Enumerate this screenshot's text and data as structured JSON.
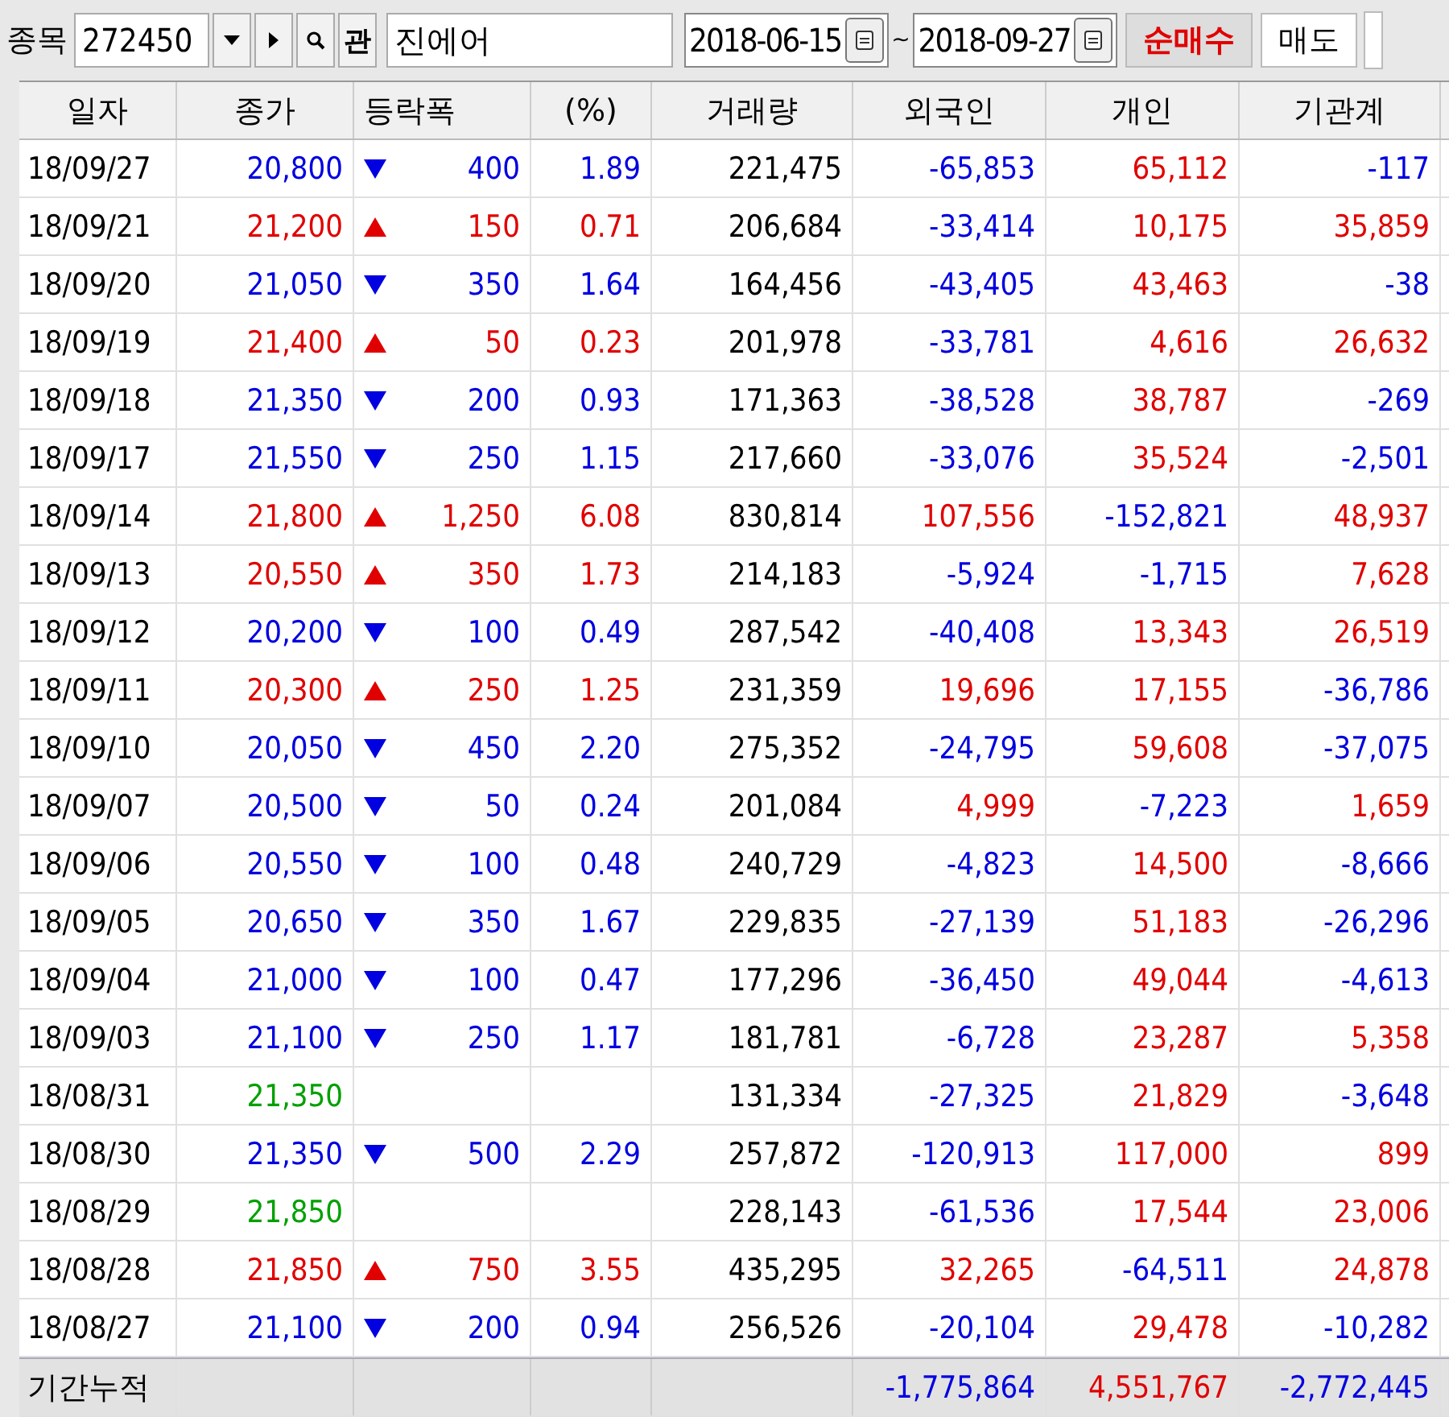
{
  "toolbar": {
    "label": "종목",
    "code": "272450",
    "name_field": "진에어",
    "related_button": "관",
    "start_date": "2018-06-15",
    "tilde": "~",
    "end_date": "2018-09-27",
    "tabs": [
      {
        "label": "순매수",
        "selected": true
      },
      {
        "label": "매도",
        "selected": false
      }
    ]
  },
  "table": {
    "columns": [
      "일자",
      "종가",
      "등락폭",
      "(%)",
      "거래량",
      "외국인",
      "개인",
      "기관계"
    ],
    "rows": [
      {
        "date": "18/09/27",
        "close": "20,800",
        "change": "400",
        "pct": "1.89",
        "kind": "down",
        "volume": "221,475",
        "flows": [
          {
            "text": "-65,853",
            "kind": "neg"
          },
          {
            "text": "65,112",
            "kind": "pos"
          },
          {
            "text": "-117",
            "kind": "neg"
          }
        ]
      },
      {
        "date": "18/09/21",
        "close": "21,200",
        "change": "150",
        "pct": "0.71",
        "kind": "up",
        "volume": "206,684",
        "flows": [
          {
            "text": "-33,414",
            "kind": "neg"
          },
          {
            "text": "10,175",
            "kind": "pos"
          },
          {
            "text": "35,859",
            "kind": "pos"
          }
        ]
      },
      {
        "date": "18/09/20",
        "close": "21,050",
        "change": "350",
        "pct": "1.64",
        "kind": "down",
        "volume": "164,456",
        "flows": [
          {
            "text": "-43,405",
            "kind": "neg"
          },
          {
            "text": "43,463",
            "kind": "pos"
          },
          {
            "text": "-38",
            "kind": "neg"
          }
        ]
      },
      {
        "date": "18/09/19",
        "close": "21,400",
        "change": "50",
        "pct": "0.23",
        "kind": "up",
        "volume": "201,978",
        "flows": [
          {
            "text": "-33,781",
            "kind": "neg"
          },
          {
            "text": "4,616",
            "kind": "pos"
          },
          {
            "text": "26,632",
            "kind": "pos"
          }
        ]
      },
      {
        "date": "18/09/18",
        "close": "21,350",
        "change": "200",
        "pct": "0.93",
        "kind": "down",
        "volume": "171,363",
        "flows": [
          {
            "text": "-38,528",
            "kind": "neg"
          },
          {
            "text": "38,787",
            "kind": "pos"
          },
          {
            "text": "-269",
            "kind": "neg"
          }
        ]
      },
      {
        "date": "18/09/17",
        "close": "21,550",
        "change": "250",
        "pct": "1.15",
        "kind": "down",
        "volume": "217,660",
        "flows": [
          {
            "text": "-33,076",
            "kind": "neg"
          },
          {
            "text": "35,524",
            "kind": "pos"
          },
          {
            "text": "-2,501",
            "kind": "neg"
          }
        ]
      },
      {
        "date": "18/09/14",
        "close": "21,800",
        "change": "1,250",
        "pct": "6.08",
        "kind": "up",
        "volume": "830,814",
        "flows": [
          {
            "text": "107,556",
            "kind": "pos"
          },
          {
            "text": "-152,821",
            "kind": "neg"
          },
          {
            "text": "48,937",
            "kind": "pos"
          }
        ]
      },
      {
        "date": "18/09/13",
        "close": "20,550",
        "change": "350",
        "pct": "1.73",
        "kind": "up",
        "volume": "214,183",
        "flows": [
          {
            "text": "-5,924",
            "kind": "neg"
          },
          {
            "text": "-1,715",
            "kind": "neg"
          },
          {
            "text": "7,628",
            "kind": "pos"
          }
        ]
      },
      {
        "date": "18/09/12",
        "close": "20,200",
        "change": "100",
        "pct": "0.49",
        "kind": "down",
        "volume": "287,542",
        "flows": [
          {
            "text": "-40,408",
            "kind": "neg"
          },
          {
            "text": "13,343",
            "kind": "pos"
          },
          {
            "text": "26,519",
            "kind": "pos"
          }
        ]
      },
      {
        "date": "18/09/11",
        "close": "20,300",
        "change": "250",
        "pct": "1.25",
        "kind": "up",
        "volume": "231,359",
        "flows": [
          {
            "text": "19,696",
            "kind": "pos"
          },
          {
            "text": "17,155",
            "kind": "pos"
          },
          {
            "text": "-36,786",
            "kind": "neg"
          }
        ]
      },
      {
        "date": "18/09/10",
        "close": "20,050",
        "change": "450",
        "pct": "2.20",
        "kind": "down",
        "volume": "275,352",
        "flows": [
          {
            "text": "-24,795",
            "kind": "neg"
          },
          {
            "text": "59,608",
            "kind": "pos"
          },
          {
            "text": "-37,075",
            "kind": "neg"
          }
        ]
      },
      {
        "date": "18/09/07",
        "close": "20,500",
        "change": "50",
        "pct": "0.24",
        "kind": "down",
        "volume": "201,084",
        "flows": [
          {
            "text": "4,999",
            "kind": "pos"
          },
          {
            "text": "-7,223",
            "kind": "neg"
          },
          {
            "text": "1,659",
            "kind": "pos"
          }
        ]
      },
      {
        "date": "18/09/06",
        "close": "20,550",
        "change": "100",
        "pct": "0.48",
        "kind": "down",
        "volume": "240,729",
        "flows": [
          {
            "text": "-4,823",
            "kind": "neg"
          },
          {
            "text": "14,500",
            "kind": "pos"
          },
          {
            "text": "-8,666",
            "kind": "neg"
          }
        ]
      },
      {
        "date": "18/09/05",
        "close": "20,650",
        "change": "350",
        "pct": "1.67",
        "kind": "down",
        "volume": "229,835",
        "flows": [
          {
            "text": "-27,139",
            "kind": "neg"
          },
          {
            "text": "51,183",
            "kind": "pos"
          },
          {
            "text": "-26,296",
            "kind": "neg"
          }
        ]
      },
      {
        "date": "18/09/04",
        "close": "21,000",
        "change": "100",
        "pct": "0.47",
        "kind": "down",
        "volume": "177,296",
        "flows": [
          {
            "text": "-36,450",
            "kind": "neg"
          },
          {
            "text": "49,044",
            "kind": "pos"
          },
          {
            "text": "-4,613",
            "kind": "neg"
          }
        ]
      },
      {
        "date": "18/09/03",
        "close": "21,100",
        "change": "250",
        "pct": "1.17",
        "kind": "down",
        "volume": "181,781",
        "flows": [
          {
            "text": "-6,728",
            "kind": "neg"
          },
          {
            "text": "23,287",
            "kind": "pos"
          },
          {
            "text": "5,358",
            "kind": "pos"
          }
        ]
      },
      {
        "date": "18/08/31",
        "close": "21,350",
        "kind": "flat",
        "volume": "131,334",
        "flows": [
          {
            "text": "-27,325",
            "kind": "neg"
          },
          {
            "text": "21,829",
            "kind": "pos"
          },
          {
            "text": "-3,648",
            "kind": "neg"
          }
        ]
      },
      {
        "date": "18/08/30",
        "close": "21,350",
        "change": "500",
        "pct": "2.29",
        "kind": "down",
        "volume": "257,872",
        "flows": [
          {
            "text": "-120,913",
            "kind": "neg"
          },
          {
            "text": "117,000",
            "kind": "pos"
          },
          {
            "text": "899",
            "kind": "pos"
          }
        ]
      },
      {
        "date": "18/08/29",
        "close": "21,850",
        "kind": "flat",
        "volume": "228,143",
        "flows": [
          {
            "text": "-61,536",
            "kind": "neg"
          },
          {
            "text": "17,544",
            "kind": "pos"
          },
          {
            "text": "23,006",
            "kind": "pos"
          }
        ]
      },
      {
        "date": "18/08/28",
        "close": "21,850",
        "change": "750",
        "pct": "3.55",
        "kind": "up",
        "volume": "435,295",
        "flows": [
          {
            "text": "32,265",
            "kind": "pos"
          },
          {
            "text": "-64,511",
            "kind": "neg"
          },
          {
            "text": "24,878",
            "kind": "pos"
          }
        ]
      },
      {
        "date": "18/08/27",
        "close": "21,100",
        "change": "200",
        "pct": "0.94",
        "kind": "down",
        "volume": "256,526",
        "flows": [
          {
            "text": "-20,104",
            "kind": "neg"
          },
          {
            "text": "29,478",
            "kind": "pos"
          },
          {
            "text": "-10,282",
            "kind": "neg"
          }
        ]
      }
    ],
    "total": {
      "label": "기간누적",
      "flows": [
        {
          "text": "-1,775,864",
          "kind": "neg"
        },
        {
          "text": "4,551,767",
          "kind": "pos"
        },
        {
          "text": "-2,772,445",
          "kind": "neg"
        }
      ]
    }
  }
}
